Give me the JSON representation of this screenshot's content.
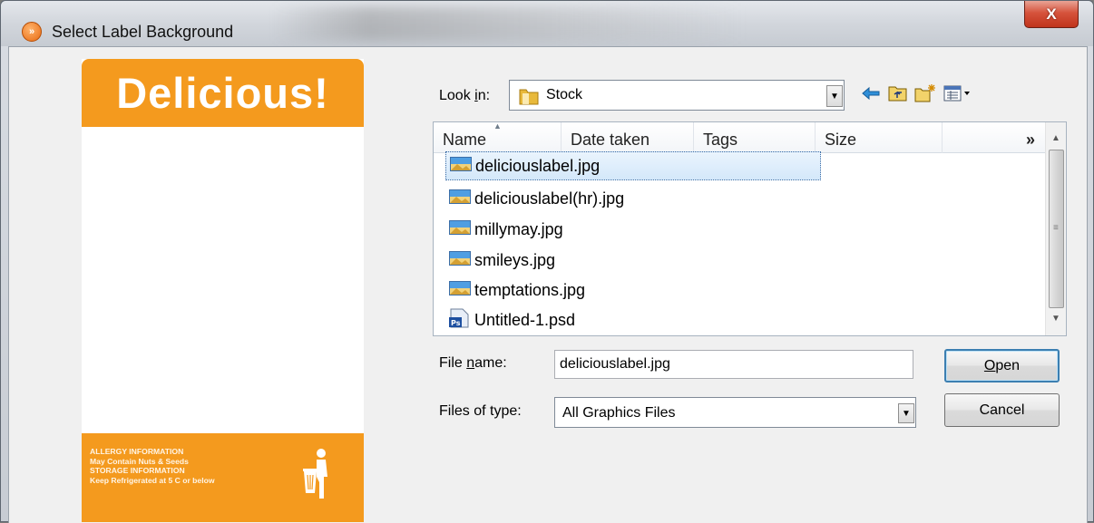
{
  "window": {
    "title": "Select Label Background",
    "close_glyph": "X",
    "app_icon": "orange-chevron-icon"
  },
  "label_preview": {
    "heading": "Delicious!",
    "allergy_lines": [
      "ALLERGY INFORMATION",
      "May Contain Nuts & Seeds",
      "STORAGE INFORMATION",
      "Keep Refrigerated at 5 C or below"
    ],
    "icon": "tidyman-bin-icon",
    "accent_color": "#f49a1e"
  },
  "look_in": {
    "label_pre": "Look ",
    "label_key": "i",
    "label_post": "n:",
    "value": "Stock"
  },
  "toolbar": {
    "icons": [
      "back-arrow-icon",
      "up-folder-icon",
      "new-folder-icon",
      "view-menu-icon"
    ]
  },
  "file_list": {
    "columns": [
      "Name",
      "Date taken",
      "Tags",
      "Size"
    ],
    "overflow_glyph": "»",
    "files": [
      {
        "name": "deliciouslabel.jpg",
        "type": "image",
        "selected": true
      },
      {
        "name": "deliciouslabel(hr).jpg",
        "type": "image",
        "selected": false
      },
      {
        "name": "millymay.jpg",
        "type": "image",
        "selected": false
      },
      {
        "name": "smileys.jpg",
        "type": "image",
        "selected": false
      },
      {
        "name": "temptations.jpg",
        "type": "image",
        "selected": false
      },
      {
        "name": "Untitled-1.psd",
        "type": "psd",
        "selected": false
      }
    ]
  },
  "file_name": {
    "label_pre": "File ",
    "label_key": "n",
    "label_post": "ame:",
    "value": "deliciouslabel.jpg"
  },
  "file_type": {
    "label": "Files of type:",
    "value": "All Graphics Files"
  },
  "buttons": {
    "open_key": "O",
    "open_rest": "pen",
    "cancel": "Cancel"
  }
}
